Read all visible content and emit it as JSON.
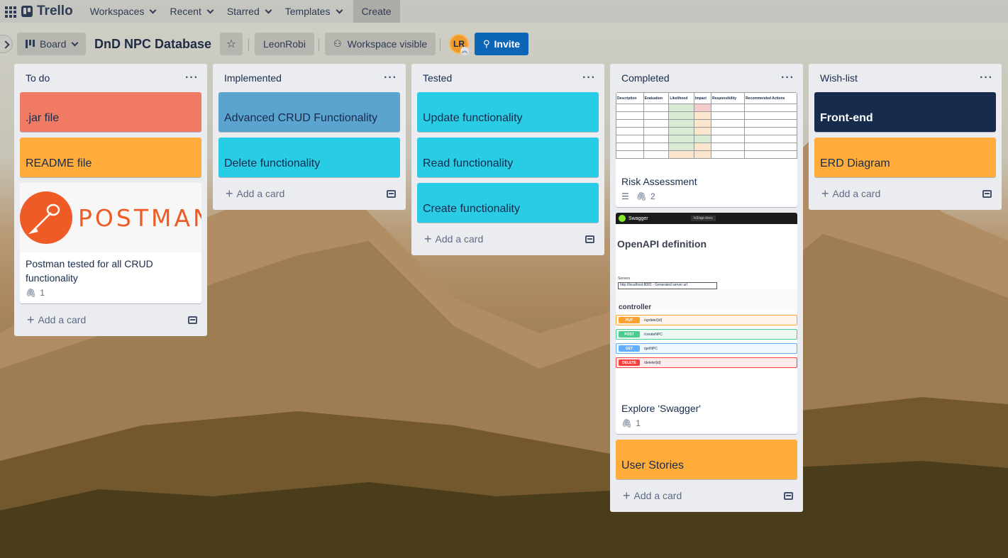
{
  "topnav": {
    "logo": "Trello",
    "items": [
      {
        "label": "Workspaces"
      },
      {
        "label": "Recent"
      },
      {
        "label": "Starred"
      },
      {
        "label": "Templates"
      }
    ],
    "create_label": "Create"
  },
  "board": {
    "view_label": "Board",
    "title": "DnD NPC Database",
    "workspace": "LeonRobi",
    "visibility": "Workspace visible",
    "avatar_initials": "LR",
    "invite_label": "Invite"
  },
  "add_card_label": "Add a card",
  "lists": {
    "todo": {
      "title": "To do",
      "cards": [
        {
          "title": ".jar file",
          "color": "#f07a63"
        },
        {
          "title": "README file",
          "color": "#ffac3a"
        }
      ],
      "postman": {
        "logo_text": "POSTMAN",
        "title": "Postman tested for all CRUD functionality",
        "attachments": "1"
      }
    },
    "implemented": {
      "title": "Implemented",
      "cards": [
        {
          "title": "Advanced CRUD Functionality",
          "color": "#5ba4cf"
        },
        {
          "title": "Delete functionality",
          "color": "#29cce5"
        }
      ]
    },
    "tested": {
      "title": "Tested",
      "cards": [
        {
          "title": "Update functionality",
          "color": "#29cce5"
        },
        {
          "title": "Read functionality",
          "color": "#29cce5"
        },
        {
          "title": "Create functionality",
          "color": "#29cce5"
        }
      ]
    },
    "completed": {
      "title": "Completed",
      "risk": {
        "title": "Risk Assessment",
        "attachments": "2",
        "table_headers": [
          "Description",
          "Evaluation",
          "Likelihood",
          "Impact",
          "Responsibility",
          "Recommended Actions"
        ]
      },
      "swagger": {
        "title": "Explore 'Swagger'",
        "attachments": "1",
        "brand": "Swagger",
        "url": "/v3/api-docs",
        "heading": "OpenAPI definition",
        "servers_label": "Servers",
        "server_value": "http://localhost:8081 - Generated server url",
        "controller": "controller",
        "ops": [
          {
            "method": "PUT",
            "path": "/update/{id}",
            "color": "#fca130",
            "bg": "#fff5ea"
          },
          {
            "method": "POST",
            "path": "/createNPC",
            "color": "#49cc90",
            "bg": "#edfaf4"
          },
          {
            "method": "GET",
            "path": "/getNPC",
            "color": "#61affe",
            "bg": "#eff7ff"
          },
          {
            "method": "DELETE",
            "path": "/delete/{id}",
            "color": "#f93e3e",
            "bg": "#feebeb"
          }
        ]
      },
      "cards": [
        {
          "title": "User Stories",
          "color": "#ffac3a"
        }
      ]
    },
    "wishlist": {
      "title": "Wish-list",
      "cards": [
        {
          "title": "Front-end",
          "color": "#172b4d"
        },
        {
          "title": "ERD Diagram",
          "color": "#ffac3a"
        }
      ]
    }
  }
}
